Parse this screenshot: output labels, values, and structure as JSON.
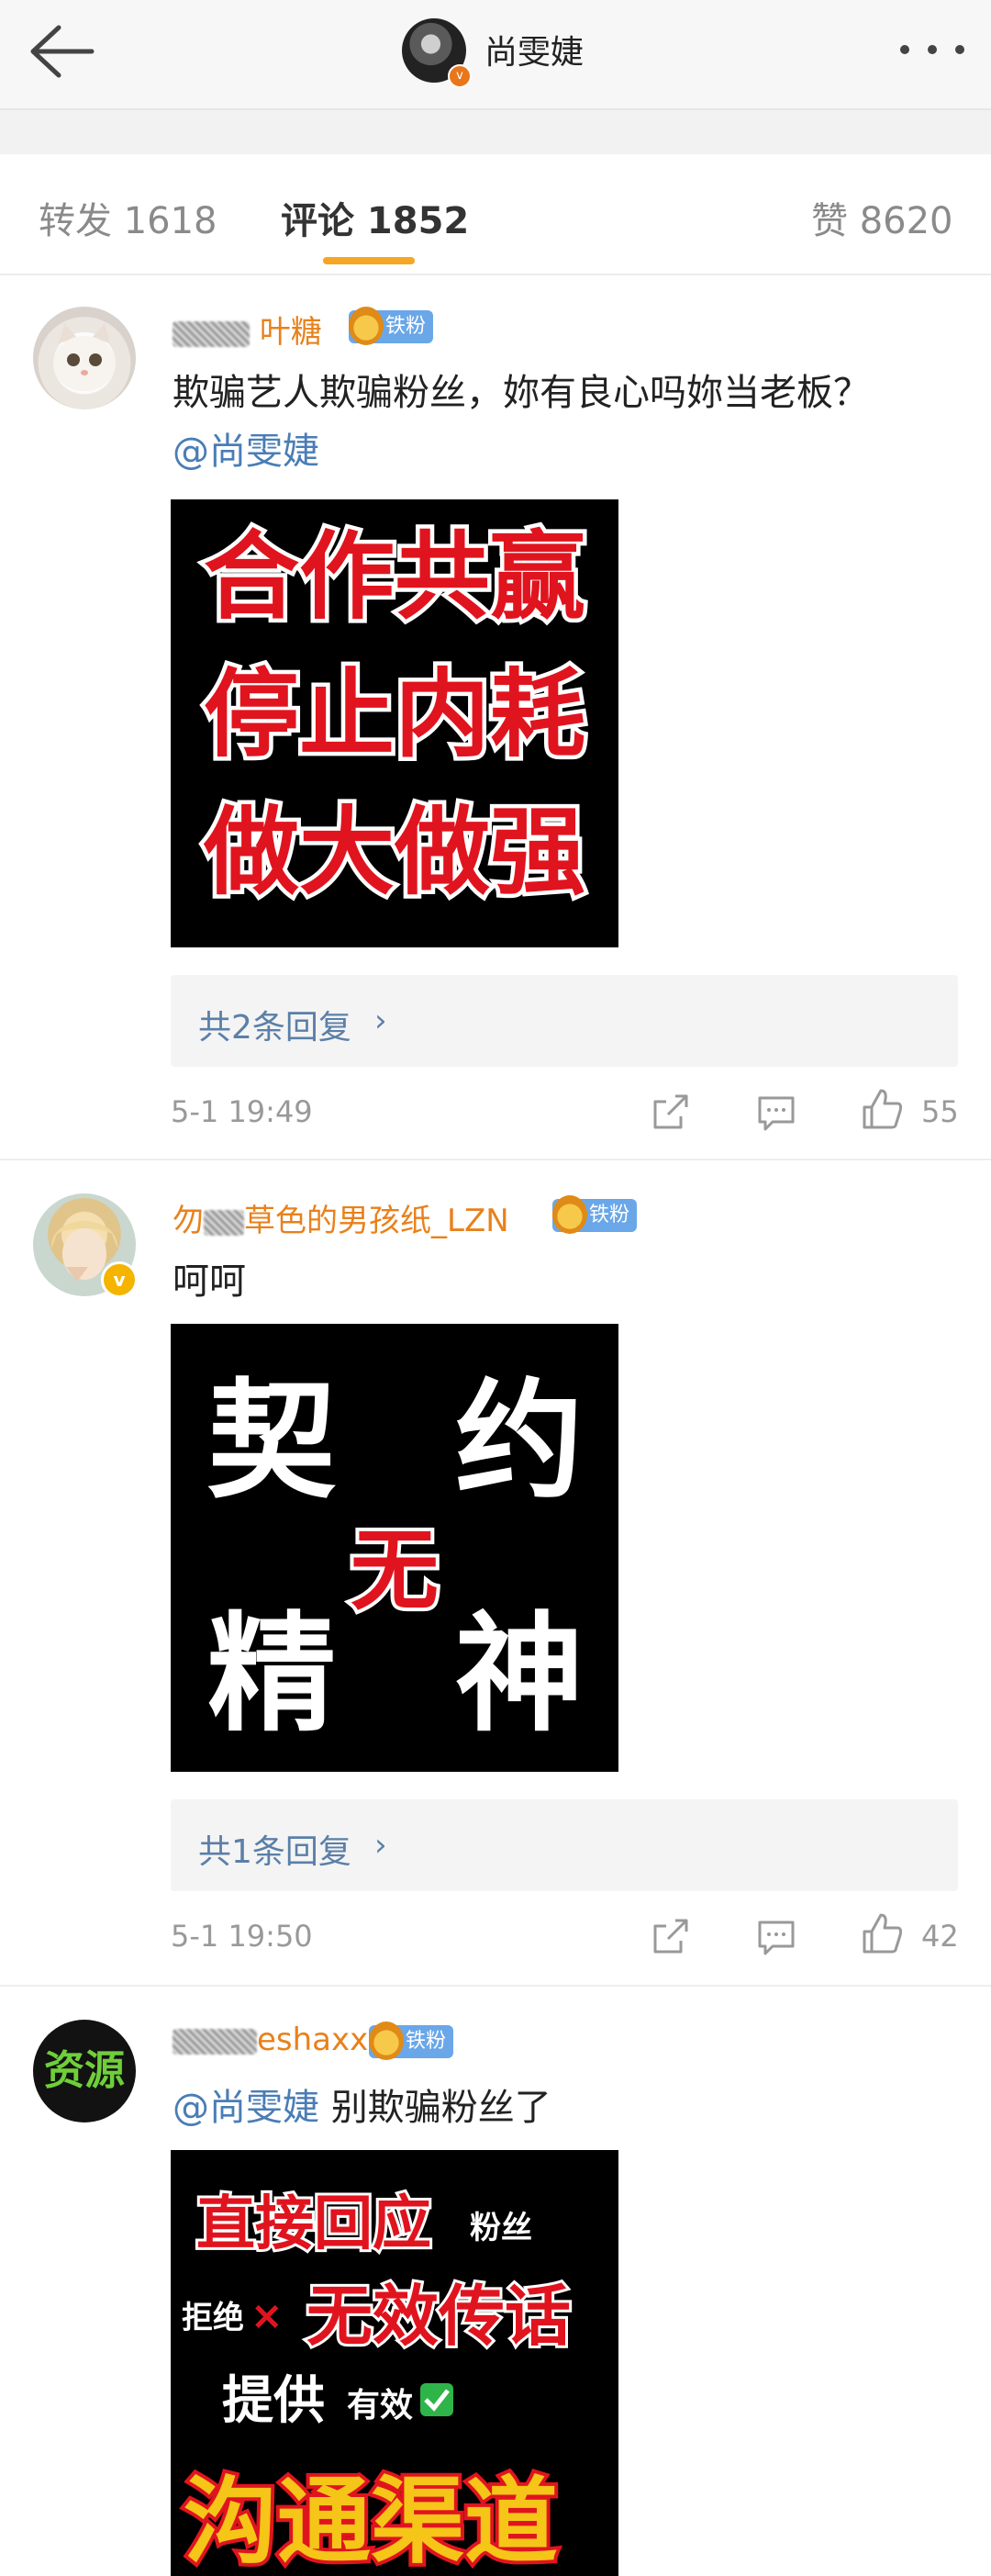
{
  "header": {
    "title": "尚雯婕"
  },
  "tabs": [
    {
      "label": "转发 1618"
    },
    {
      "label": "评论 1852"
    },
    {
      "label": "赞 8620"
    }
  ],
  "fan_badge_label": "铁粉",
  "colors": {
    "accent": "#f5a623",
    "username": "#e8811c",
    "mention": "#4a7db6",
    "fan_badge": "#6aa7e8"
  },
  "comments": [
    {
      "username": "叶糖",
      "text": "欺骗艺人欺骗粉丝，妳有良心吗妳当老板？",
      "mention": "@尚雯婕",
      "image_lines": [
        "合作共赢",
        "停止内耗",
        "做大做强"
      ],
      "replies": "共2条回复",
      "time": "5-1 19:49",
      "likes": "55"
    },
    {
      "username": "草色的男孩纸_LZN",
      "username_prefix": "勿",
      "text": "呵呵",
      "image_words": [
        "契",
        "约",
        "无",
        "精",
        "神"
      ],
      "replies": "共1条回复",
      "time": "5-1 19:50",
      "likes": "42"
    },
    {
      "username": "eshaxx",
      "avatar_text": "资源",
      "mention": "@尚雯婕",
      "text": "别欺骗粉丝了",
      "image_lines": [
        "直接回应",
        "粉丝",
        "拒绝",
        "无效传话",
        "提供",
        "有效",
        "沟通渠道"
      ]
    }
  ]
}
